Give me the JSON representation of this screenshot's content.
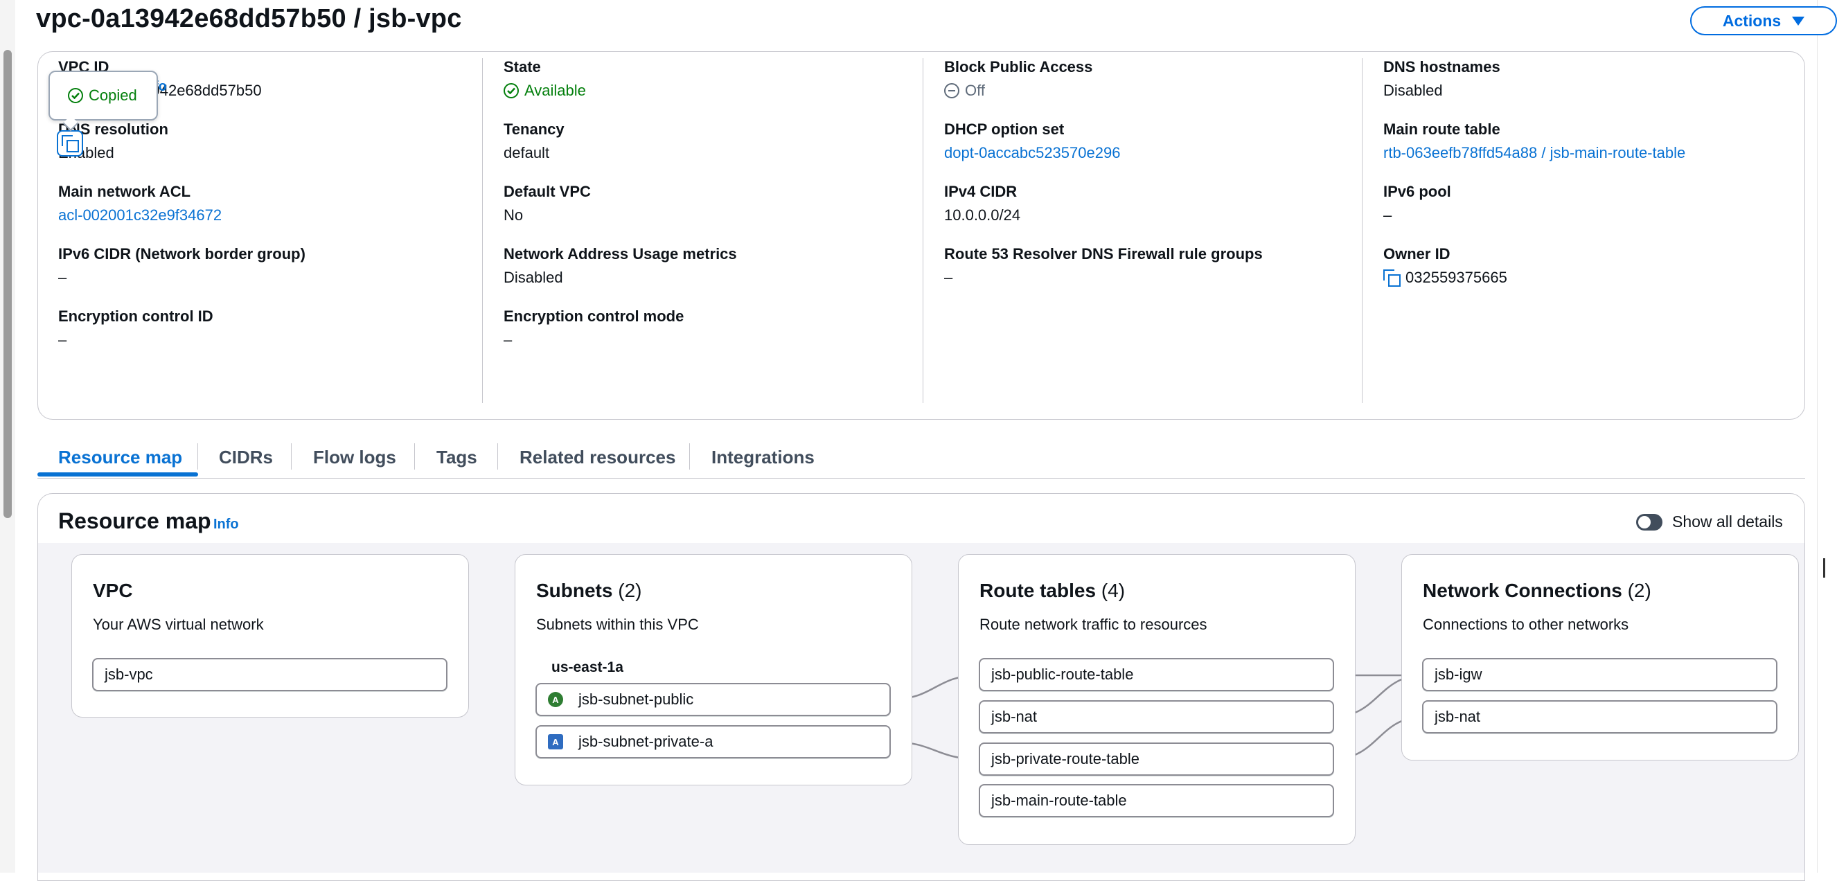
{
  "page": {
    "title": "vpc-0a13942e68dd57b50 / jsb-vpc",
    "actions_label": "Actions"
  },
  "tooltip": {
    "text": "Copied",
    "info_peek": "fo"
  },
  "details": {
    "vpc_id": {
      "label": "VPC ID",
      "value": "vpc-0a13942e68dd57b50"
    },
    "state": {
      "label": "State",
      "value": "Available"
    },
    "block_public_access": {
      "label": "Block Public Access",
      "value": "Off"
    },
    "dns_hostnames": {
      "label": "DNS hostnames",
      "value": "Disabled"
    },
    "dns_resolution": {
      "label": "DNS resolution",
      "value": "Enabled"
    },
    "tenancy": {
      "label": "Tenancy",
      "value": "default"
    },
    "dhcp_option_set": {
      "label": "DHCP option set",
      "value": "dopt-0accabc523570e296"
    },
    "main_route_table": {
      "label": "Main route table",
      "value": "rtb-063eefb78ffd54a88 / jsb-main-route-table"
    },
    "main_network_acl": {
      "label": "Main network ACL",
      "value": "acl-002001c32e9f34672"
    },
    "default_vpc": {
      "label": "Default VPC",
      "value": "No"
    },
    "ipv4_cidr": {
      "label": "IPv4 CIDR",
      "value": "10.0.0.0/24"
    },
    "ipv6_pool": {
      "label": "IPv6 pool",
      "value": "–"
    },
    "ipv6_cidr": {
      "label": "IPv6 CIDR (Network border group)",
      "value": "–"
    },
    "network_address_usage": {
      "label": "Network Address Usage metrics",
      "value": "Disabled"
    },
    "route53_resolver": {
      "label": "Route 53 Resolver DNS Firewall rule groups",
      "value": "–"
    },
    "owner_id": {
      "label": "Owner ID",
      "value": "032559375665"
    },
    "encryption_control_id": {
      "label": "Encryption control ID",
      "value": "–"
    },
    "encryption_control_mode": {
      "label": "Encryption control mode",
      "value": "–"
    }
  },
  "tabs": [
    "Resource map",
    "CIDRs",
    "Flow logs",
    "Tags",
    "Related resources",
    "Integrations"
  ],
  "active_tab": "Resource map",
  "resource_map": {
    "title": "Resource map",
    "info": "Info",
    "show_all_details": "Show all details",
    "vpc": {
      "title": "VPC",
      "subtitle": "Your AWS virtual network",
      "items": [
        "jsb-vpc"
      ]
    },
    "subnets": {
      "title": "Subnets",
      "count": "(2)",
      "subtitle": "Subnets within this VPC",
      "az": "us-east-1a",
      "items": [
        {
          "badge": "A",
          "badge_shape": "circle",
          "name": "jsb-subnet-public"
        },
        {
          "badge": "A",
          "badge_shape": "square",
          "name": "jsb-subnet-private-a"
        }
      ]
    },
    "route_tables": {
      "title": "Route tables",
      "count": "(4)",
      "subtitle": "Route network traffic to resources",
      "items": [
        "jsb-public-route-table",
        "jsb-nat",
        "jsb-private-route-table",
        "jsb-main-route-table"
      ]
    },
    "network_connections": {
      "title": "Network Connections",
      "count": "(2)",
      "subtitle": "Connections to other networks",
      "items": [
        "jsb-igw",
        "jsb-nat"
      ]
    }
  },
  "colors": {
    "link": "#0972d3",
    "success": "#037f0c",
    "accent": "#006ce0",
    "text": "#0f141a"
  }
}
